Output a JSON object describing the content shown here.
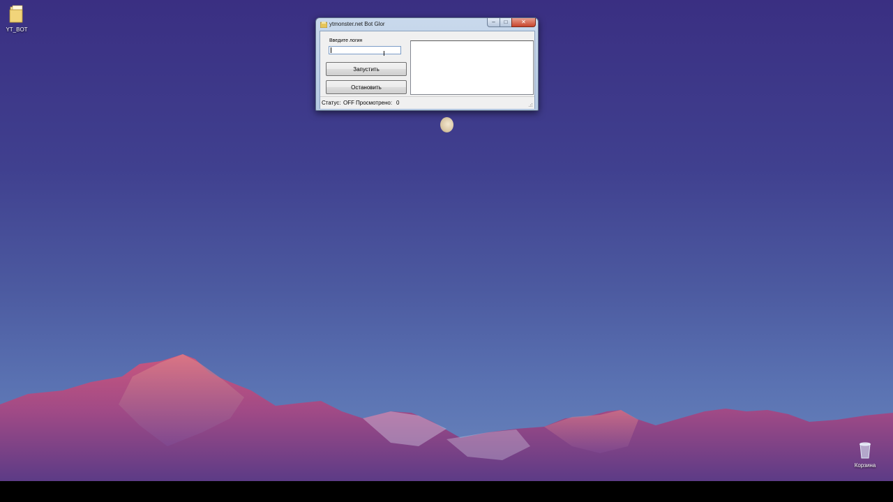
{
  "desktop": {
    "icons": [
      {
        "label": "YT_BOT"
      },
      {
        "label": "Корзина"
      }
    ]
  },
  "window": {
    "title": "ytmonster.net Bot Glor",
    "controls": {
      "minimize": "–",
      "maximize": "□",
      "close": "✕"
    },
    "login_label": "Введите логин",
    "login_value": "",
    "start_label": "Запустить",
    "stop_label": "Остановить",
    "log_text": "",
    "status": {
      "status_label": "Статус:",
      "status_value": "OFF",
      "viewed_label": "Просмотрено:",
      "viewed_value": "0"
    }
  }
}
